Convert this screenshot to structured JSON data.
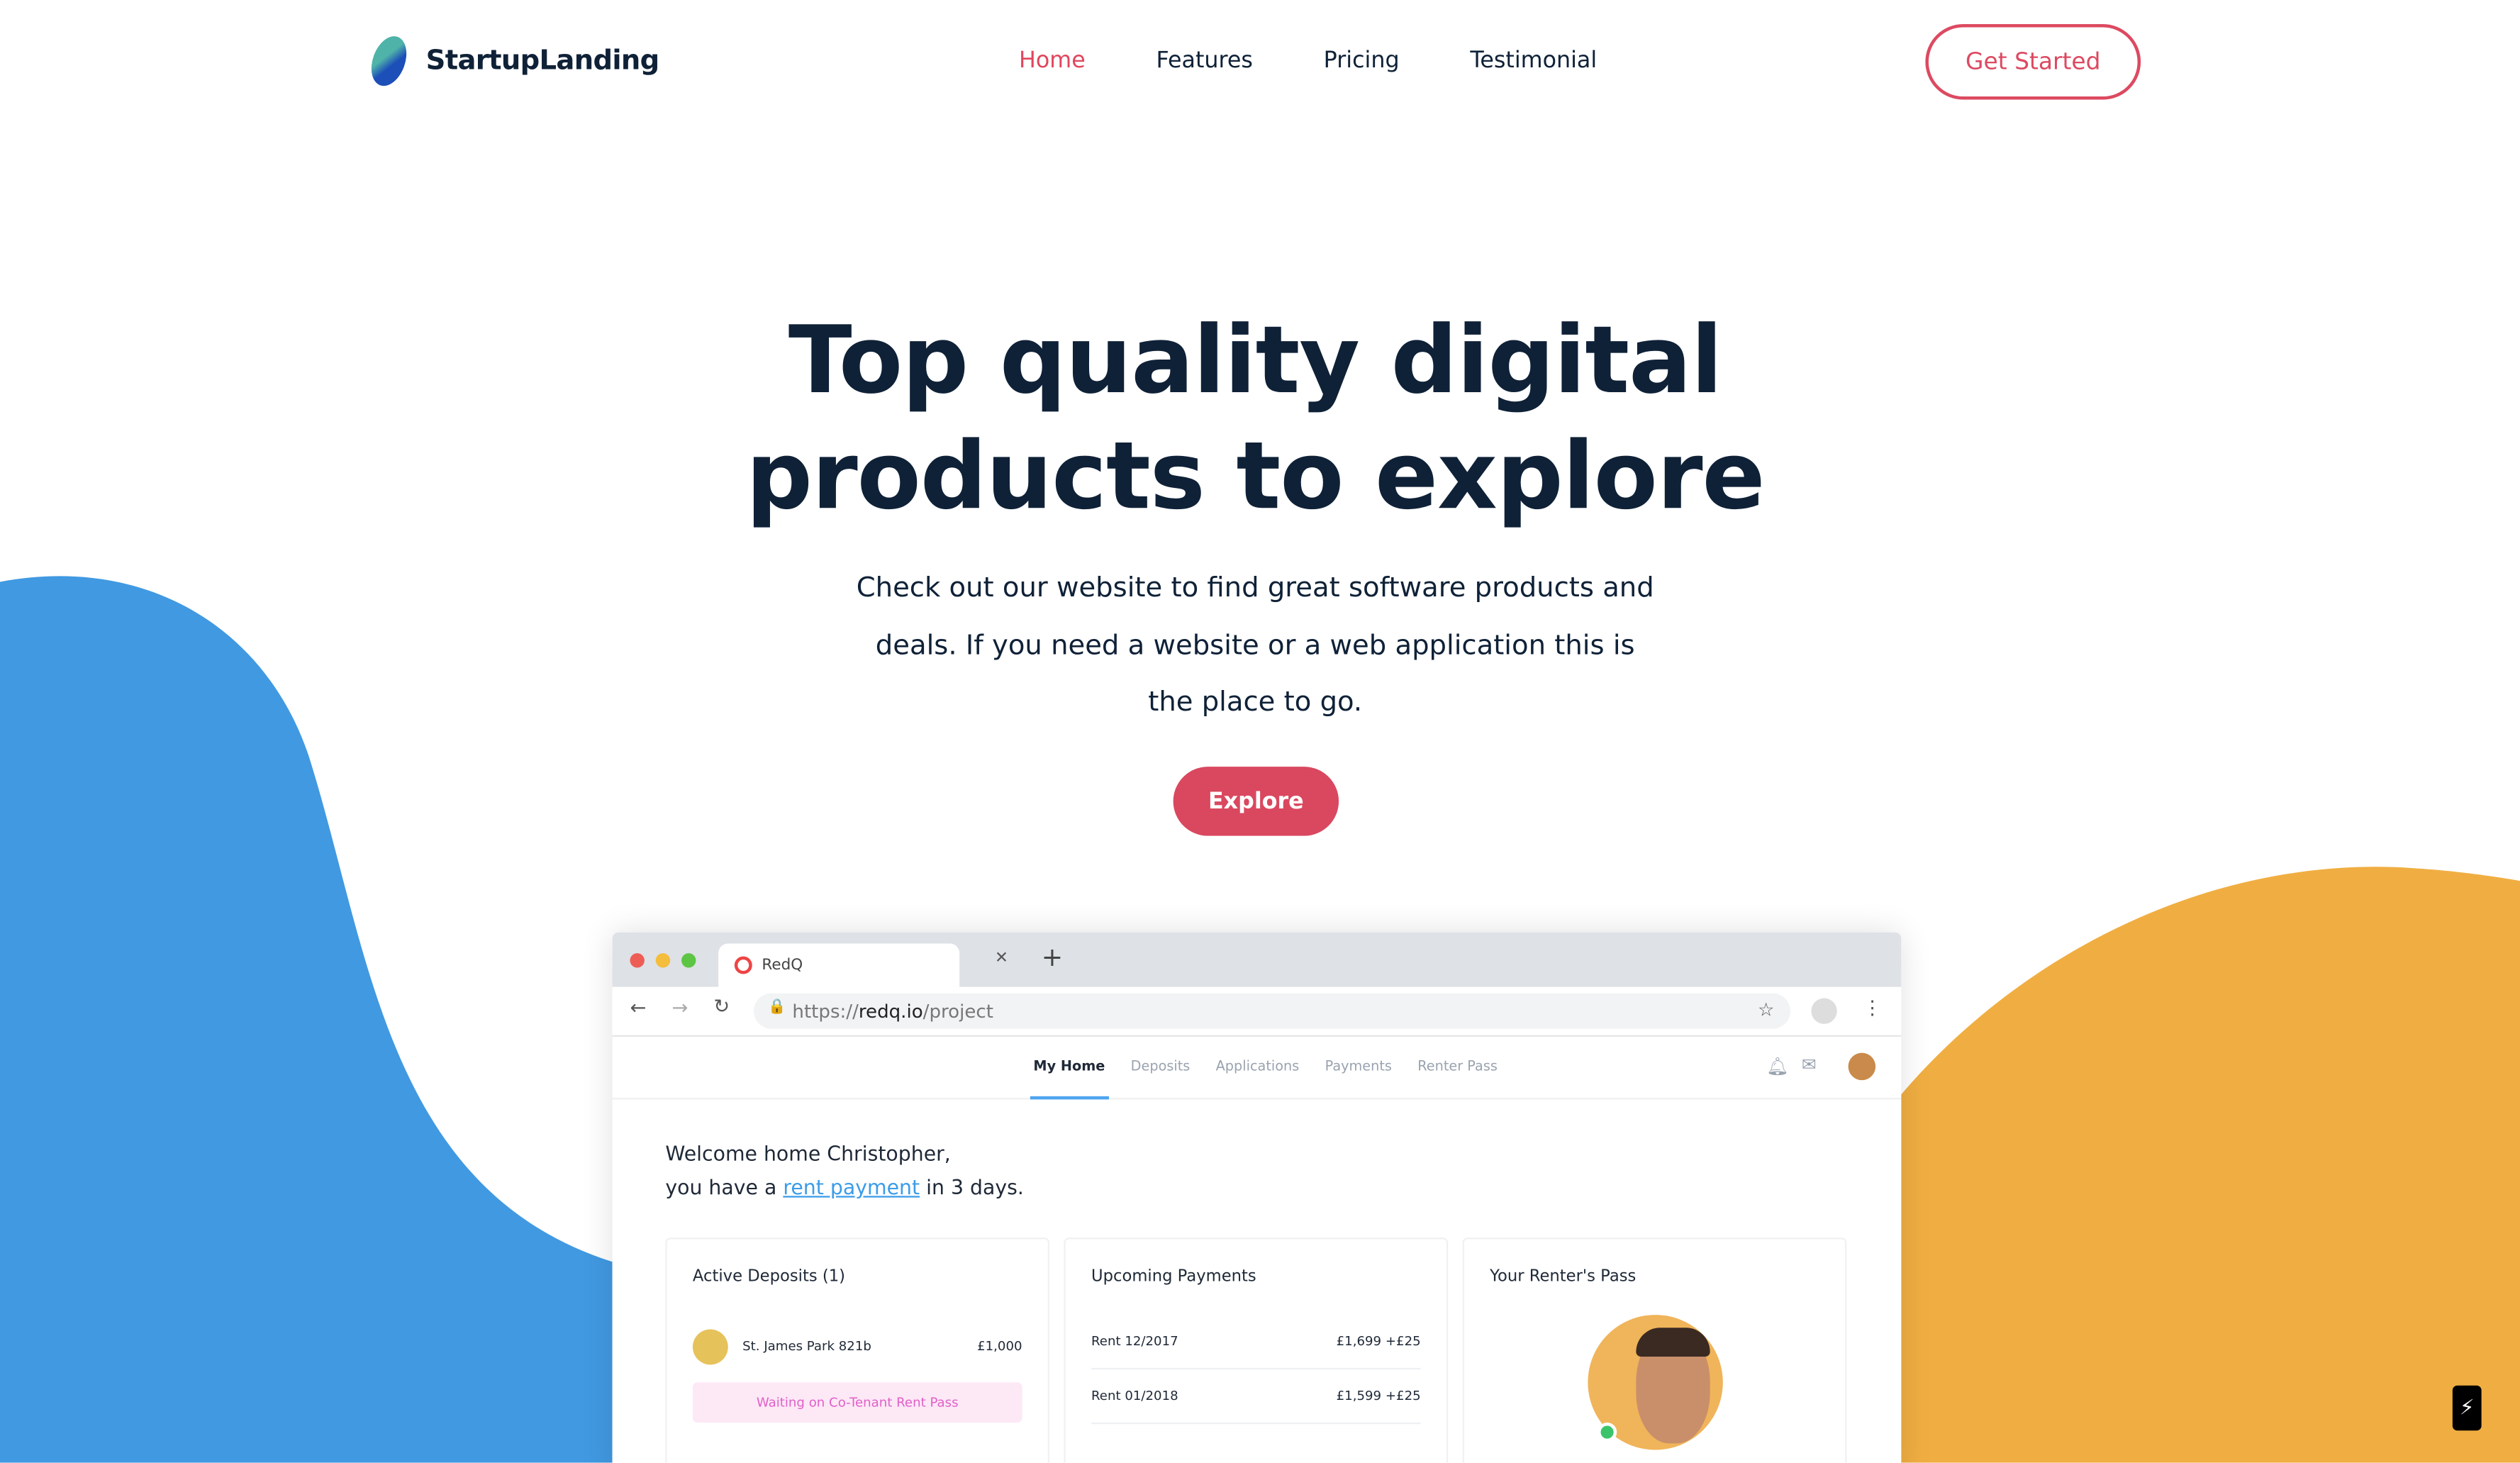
{
  "colors": {
    "accent": "#d9485f",
    "blue_blob": "#4199e1",
    "yellow_blob": "#f0ae42",
    "heading": "#0f2137"
  },
  "header": {
    "logo_text": "StartupLanding",
    "nav": [
      {
        "label": "Home",
        "active": true
      },
      {
        "label": "Features"
      },
      {
        "label": "Pricing"
      },
      {
        "label": "Testimonial"
      }
    ],
    "cta_label": "Get Started"
  },
  "hero": {
    "title_line1": "Top quality digital",
    "title_line2": "products to explore",
    "subtitle": "Check out our website to find great software products and deals. If you need a website or a web application this is the place to go.",
    "button_label": "Explore"
  },
  "mockup": {
    "tab_title": "RedQ",
    "url_prefix": "https://",
    "url_host": "redq.io",
    "url_path": "/project",
    "nav": [
      "My Home",
      "Deposits",
      "Applications",
      "Payments",
      "Renter Pass"
    ],
    "welcome_line1": "Welcome home Christopher,",
    "welcome_pre": "you have a ",
    "welcome_link": "rent payment",
    "welcome_post": " in 3 days.",
    "deposits": {
      "title": "Active Deposits (1)",
      "property": "St. James Park 821b",
      "amount": "£1,000",
      "status": "Waiting on Co-Tenant Rent Pass"
    },
    "payments": {
      "title": "Upcoming Payments",
      "rows": [
        {
          "label": "Rent 12/2017",
          "amount": "£1,699 +£25"
        },
        {
          "label": "Rent 01/2018",
          "amount": "£1,599 +£25"
        }
      ]
    },
    "pass": {
      "title": "Your Renter's Pass"
    }
  },
  "icons": [
    "lightning-icon"
  ]
}
